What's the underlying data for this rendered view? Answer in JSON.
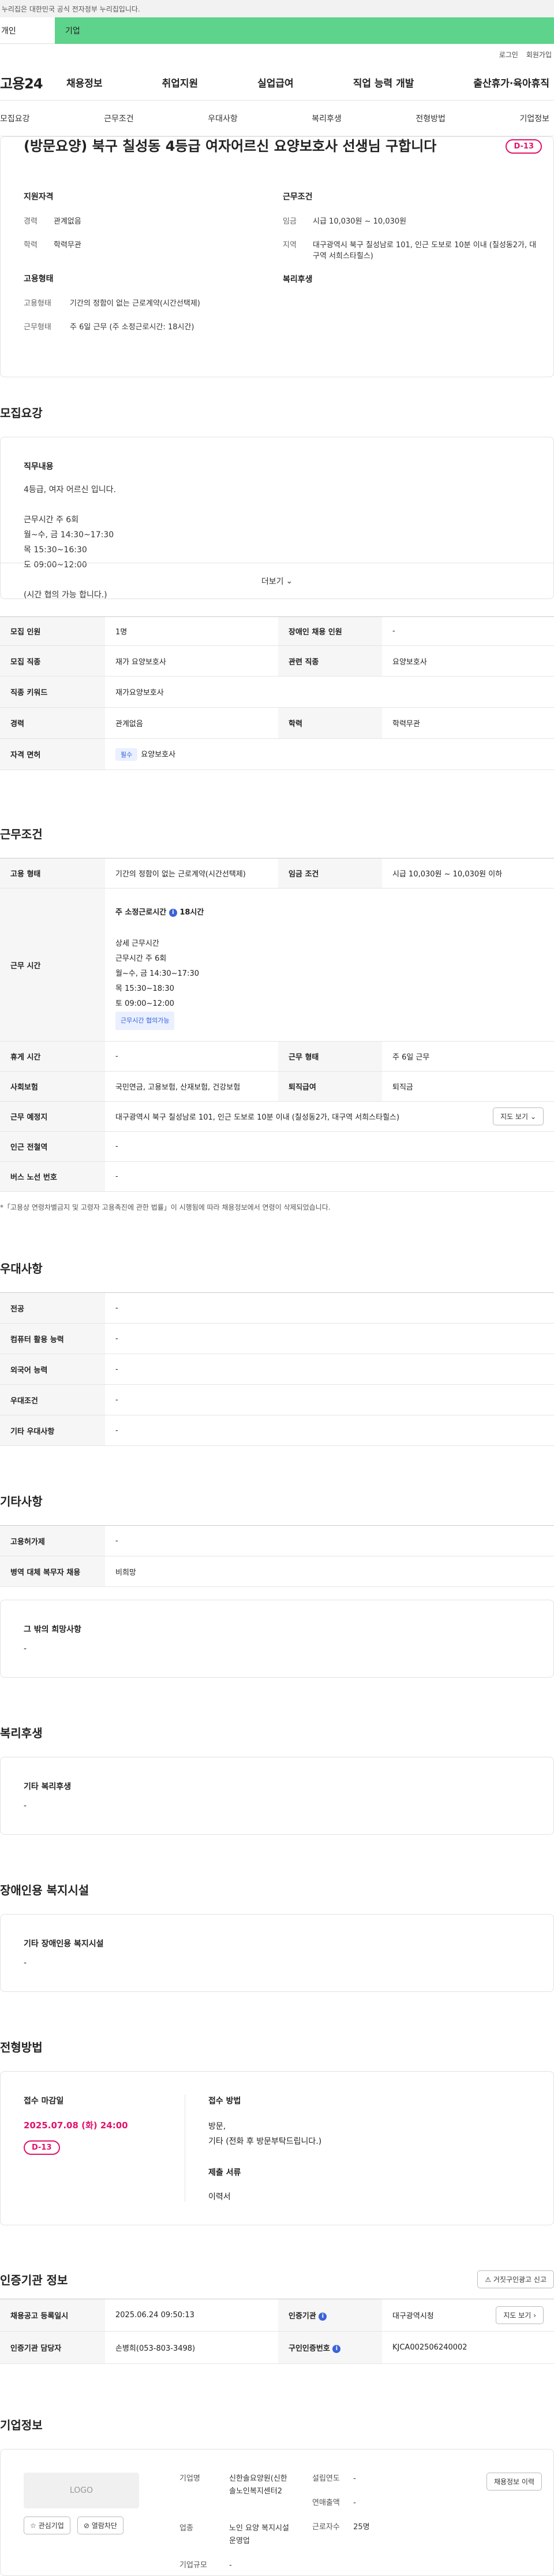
{
  "gov_banner": "이 누리집은 대한민국 공식 전자정부 누리집입니다.",
  "user_types": [
    "개인",
    "기업"
  ],
  "util": [
    "로그인",
    "회원가입"
  ],
  "logo": "고용24",
  "gnb": [
    "채용정보",
    "취업지원",
    "실업급여",
    "직업 능력 개발",
    "출산휴가·육아휴직"
  ],
  "tabs": [
    "모집요강",
    "근무조건",
    "우대사항",
    "복리후생",
    "전형방법",
    "기업정보"
  ],
  "job": {
    "title": "(방문요양) 북구 칠성동 4등급 여자어르신 요양보호사 선생님 구합니다",
    "dday": "D-13",
    "summary": {
      "qual_title": "지원자격",
      "qual": [
        {
          "k": "경력",
          "v": "관계없음"
        },
        {
          "k": "학력",
          "v": "학력무관"
        }
      ],
      "work_title": "근무조건",
      "work": [
        {
          "k": "임금",
          "v": "시급 10,030원 ~ 10,030원"
        },
        {
          "k": "지역",
          "v": "대구광역시 북구 칠성남로 101, 인근 도보로 10분 이내 (칠성동2가, 대구역 서희스타힐스)"
        }
      ],
      "emp_title": "고용형태",
      "emp": [
        {
          "k": "고용형태",
          "v": "기간의 정함이 없는 근로계약(시간선택제)"
        },
        {
          "k": "근무형태",
          "v": "주 6일 근무 (주 소정근로시간: 18시간)"
        }
      ],
      "welfare_title": "복리후생"
    }
  },
  "recruit": {
    "title": "모집요강",
    "duty_title": "직무내용",
    "duty_lines": [
      "4등급, 여자 어르신 입니다.",
      "",
      "근무시간 주 6회",
      "월~수, 금 14:30~17:30",
      "목 15:30~16:30",
      "토 09:00~12:00",
      "",
      "(시간 협의 가능 합니다.)"
    ],
    "more": "더보기",
    "rows": [
      {
        "k1": "모집 인원",
        "v1": "1명",
        "k2": "장애인 채용 인원",
        "v2": "-"
      },
      {
        "k1": "모집 직종",
        "v1": "재가 요양보호사",
        "k2": "관련 직종",
        "v2": "요양보호사"
      },
      {
        "k1": "직종 키워드",
        "v1": "재가요양보호사"
      },
      {
        "k1": "경력",
        "v1": "관계없음",
        "k2": "학력",
        "v2": "학력무관"
      },
      {
        "k1": "자격 면허",
        "badge": "필수",
        "v1": "요양보호사"
      }
    ]
  },
  "work": {
    "title": "근무조건",
    "emp_k": "고용 형태",
    "emp_v": "기간의 정함이 없는 근로계약(시간선택제)",
    "wage_k": "임금 조건",
    "wage_v": "시급 10,030원 ~ 10,030원 이하",
    "time_k": "근무 시간",
    "time_head": "주 소정근로시간",
    "time_hours": "18시간",
    "time_detail_title": "상세 근무시간",
    "time_lines": [
      "근무시간 주 6회",
      "월~수, 금 14:30~17:30",
      "목 15:30~18:30",
      "토 09:00~12:00"
    ],
    "time_badge": "근무시간 협의가능",
    "rest_k": "휴게 시간",
    "rest_v": "-",
    "type_k": "근무 형태",
    "type_v": "주 6일 근무",
    "ins_k": "사회보험",
    "ins_v": "국민연금, 고용보험, 산재보험, 건강보험",
    "ret_k": "퇴직급여",
    "ret_v": "퇴직금",
    "loc_k": "근무 예정지",
    "loc_v": "대구광역시 북구 칠성남로 101, 인근 도보로 10분 이내 (칠성동2가, 대구역 서희스타힐스)",
    "map_btn": "지도 보기",
    "sub_k": "인근 전철역",
    "sub_v": "-",
    "bus_k": "버스 노선 번호",
    "bus_v": "-",
    "note": "*「고용상 연령차별금지 및 고령자 고용촉진에 관한 법률」이 시행됨에 따라 채용정보에서 연령이 삭제되었습니다."
  },
  "pref": {
    "title": "우대사항",
    "rows": [
      {
        "k": "전공",
        "v": "-"
      },
      {
        "k": "컴퓨터 활용 능력",
        "v": "-"
      },
      {
        "k": "외국어 능력",
        "v": "-"
      },
      {
        "k": "우대조건",
        "v": "-"
      },
      {
        "k": "기타 우대사항",
        "v": "-"
      }
    ]
  },
  "etc": {
    "title": "기타사항",
    "rows": [
      {
        "k": "고용허가제",
        "v": "-"
      },
      {
        "k": "병역 대체 복무자 채용",
        "v": "비희망"
      }
    ],
    "wish_title": "그 밖의 희망사항",
    "wish_v": "-"
  },
  "welfare": {
    "title": "복리후생",
    "box_title": "기타 복리후생",
    "box_v": "-"
  },
  "disabled": {
    "title": "장애인용 복지시설",
    "box_title": "기타 장애인용 복지시설",
    "box_v": "-"
  },
  "selection": {
    "title": "전형방법",
    "deadline_title": "접수 마감일",
    "deadline": "2025.07.08 (화) 24:00",
    "dday": "D-13",
    "method_title": "접수 방법",
    "method_lines": [
      "방문,",
      "기타 (전화 후 방문부탁드립니다.)"
    ],
    "docs_title": "제출 서류",
    "docs_v": "이력서"
  },
  "agency": {
    "title": "인증기관 정보",
    "report_btn": "거짓구인광고 신고",
    "reg_k": "채용공고 등록일시",
    "reg_v": "2025.06.24 09:50:13",
    "org_k": "인증기관",
    "org_v": "대구광역시청",
    "map_btn": "지도 보기",
    "mgr_k": "인증기관 담당자",
    "mgr_v": "손병희(053-803-3498)",
    "cert_k": "구인인증번호",
    "cert_v": "KJCA002506240002"
  },
  "company": {
    "title": "기업정보",
    "logo_text": "LOGO",
    "fav_btn": "관심기업",
    "block_btn": "열람차단",
    "rows_a": [
      {
        "k": "기업명",
        "v": "신한솔요양원(신한솔노인복지센터2"
      },
      {
        "k": "업종",
        "v": "노인 요양 복지시설 운영업"
      },
      {
        "k": "기업규모",
        "v": "-"
      }
    ],
    "rows_b": [
      {
        "k": "설립연도",
        "v": "-"
      },
      {
        "k": "연매출액",
        "v": "-"
      },
      {
        "k": "근로자수",
        "v": "25명"
      }
    ],
    "history_btn": "채용정보 이력"
  },
  "colors": {
    "accent_green": "#5ed38b",
    "dday_pink": "#e2126b",
    "info_blue": "#3a63d8"
  }
}
